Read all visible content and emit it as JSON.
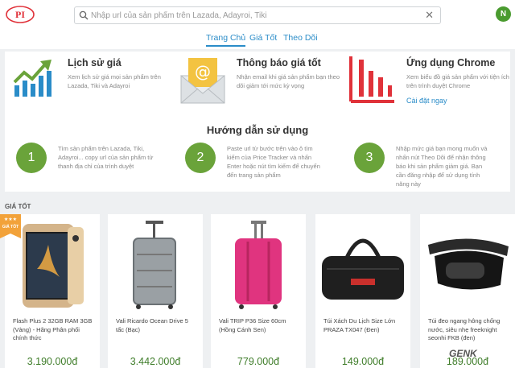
{
  "header": {
    "logo_text": "PI",
    "search_placeholder": "Nhập url của sản phẩm trên Lazada, Adayroi, Tiki",
    "clear_icon": "close-icon",
    "avatar_initial": "N",
    "accent": "#2a8cc8",
    "avatar_color": "#4a9b2f"
  },
  "tabs": [
    {
      "label": "Trang Chủ",
      "active": true
    },
    {
      "label": "Giá Tốt",
      "active": false
    },
    {
      "label": "Theo Dõi",
      "active": false
    }
  ],
  "features": [
    {
      "icon": "price-history-chart-icon",
      "title": "Lịch sử giá",
      "desc": "Xem lịch sử giá mọi sản phẩm trên Lazada, Tiki và Adayroi"
    },
    {
      "icon": "email-envelope-icon",
      "title": "Thông báo giá tốt",
      "desc": "Nhận email khi giá sản phẩm bạn theo dõi giảm tới mức kỳ vọng"
    },
    {
      "icon": "bar-chart-icon",
      "title": "Ứng dụng Chrome",
      "desc": "Xem biểu đồ giá sản phẩm với tiện ích trên trình duyệt Chrome",
      "link": "Cài đặt ngay"
    }
  ],
  "guide": {
    "title": "Hướng dẫn sử dụng",
    "steps": [
      {
        "number": "1",
        "desc": "Tìm sản phẩm trên Lazada, Tiki, Adayroi... copy url của sản phẩm từ thanh địa chỉ của trình duyệt"
      },
      {
        "number": "2",
        "desc": "Paste url từ bước trên vào ô tìm kiếm của Price Tracker và nhấn Enter hoặc nút tìm kiếm để chuyển đến trang sản phẩm"
      },
      {
        "number": "3",
        "desc": "Nhập mức giá bạn mong muốn và nhấn nút Theo Dõi để nhận thông báo khi sản phẩm giảm giá. Bạn cần đăng nhập để sử dụng tính năng này"
      }
    ]
  },
  "deals": {
    "heading": "GIÁ TỐT",
    "badge_text": "GIÁ TỐT",
    "price_color": "#3f7d2a",
    "products": [
      {
        "image": "smartphone-gold",
        "name": "Flash Plus 2 32GB RAM 3GB (Vàng) - Hãng Phân phối chính thức",
        "price": "3.190.000đ"
      },
      {
        "image": "suitcase-silver",
        "name": "Vali Ricardo Ocean Drive 5 tấc (Bạc)",
        "price": "3.442.000đ"
      },
      {
        "image": "suitcase-pink",
        "name": "Vali TRIP P36 Size 60cm (Hồng Cánh Sen)",
        "price": "779.000đ"
      },
      {
        "image": "duffel-bag-black",
        "name": "Túi Xách Du Lịch Size Lớn PRAZA TX047 (Đen)",
        "price": "149.000đ"
      },
      {
        "image": "waist-bag-black",
        "name": "Túi đeo ngang hông chống nước, siêu nhẹ freeknight seonhi FKB (đen)",
        "price": "189.000đ"
      }
    ]
  },
  "watermark": "GENK"
}
